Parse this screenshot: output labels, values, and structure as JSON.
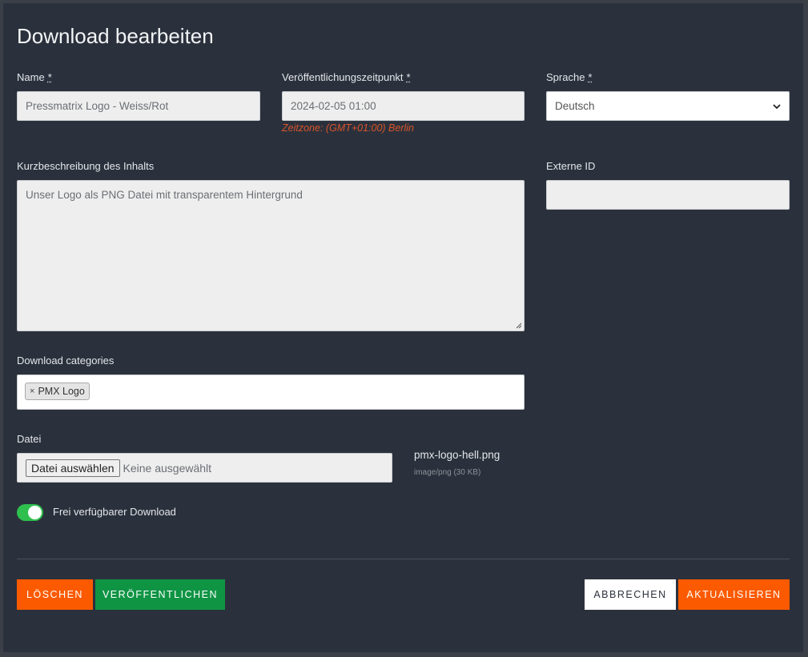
{
  "dialog": {
    "title": "Download bearbeiten"
  },
  "form": {
    "name": {
      "label": "Name",
      "required_mark": "*",
      "value": "Pressmatrix Logo - Weiss/Rot"
    },
    "publish_time": {
      "label": "Veröffentlichungszeitpunkt",
      "required_mark": "*",
      "value": "2024-02-05 01:00",
      "timezone_note": "Zeitzone: (GMT+01:00) Berlin"
    },
    "language": {
      "label": "Sprache",
      "required_mark": "*",
      "selected": "Deutsch"
    },
    "description": {
      "label": "Kurzbeschreibung des Inhalts",
      "value": "Unser Logo als PNG Datei mit transparentem Hintergrund"
    },
    "external_id": {
      "label": "Externe ID",
      "value": ""
    },
    "categories": {
      "label": "Download categories",
      "tags": [
        {
          "remove": "×",
          "label": "PMX Logo"
        }
      ]
    },
    "file": {
      "label": "Datei",
      "choose_button": "Datei auswählen",
      "no_file_text": "Keine ausgewählt",
      "current_name": "pmx-logo-hell.png",
      "current_meta": "image/png (30 KB)"
    },
    "free_download": {
      "label": "Frei verfügbarer Download",
      "enabled": true
    }
  },
  "actions": {
    "delete": "LÖSCHEN",
    "publish": "VERÖFFENTLICHEN",
    "cancel": "ABBRECHEN",
    "update": "AKTUALISIEREN"
  },
  "colors": {
    "background": "#2b313c",
    "accent_orange": "#fb5a00",
    "accent_green": "#0f9444",
    "toggle_on": "#2fbf4e",
    "timezone_text": "#d9542b"
  },
  "icons": {
    "select": "chevron-down-icon",
    "resize": "resize-grip-icon",
    "tag_remove": "close-icon"
  }
}
